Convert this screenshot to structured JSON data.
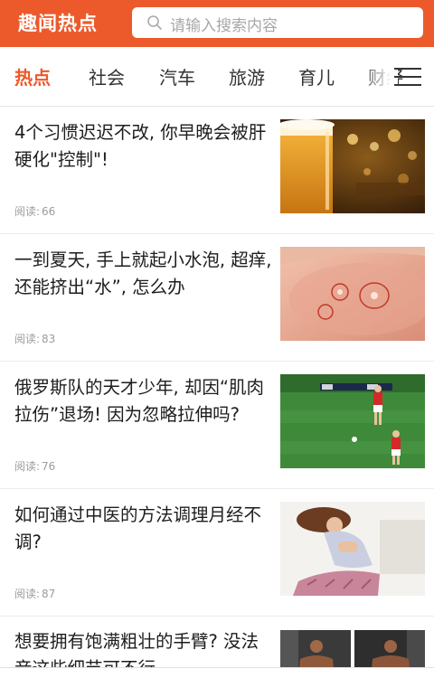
{
  "header": {
    "brand": "趣闻热点",
    "search_placeholder": "请输入搜索内容"
  },
  "tabs": [
    "热点",
    "社会",
    "汽车",
    "旅游",
    "育儿",
    "财经"
  ],
  "active_tab": "热点",
  "feed": [
    {
      "title": "4个习惯迟迟不改, 你早晚会被肝硬化\"控制\"!",
      "read_label": "阅读:",
      "reads": "66",
      "image": "beer-bar-photo"
    },
    {
      "title": "一到夏天, 手上就起小水泡, 超痒, 还能挤出“水”, 怎么办",
      "read_label": "阅读:",
      "reads": "83",
      "image": "finger-blister-photo"
    },
    {
      "title": "俄罗斯队的天才少年, 却因“肌肉拉伤”退场! 因为忽略拉伸吗?",
      "read_label": "阅读:",
      "reads": "76",
      "image": "soccer-match-photo"
    },
    {
      "title": "如何通过中医的方法调理月经不调?",
      "read_label": "阅读:",
      "reads": "87",
      "image": "woman-stomachache-photo"
    }
  ],
  "partial_item": {
    "title": "想要拥有饱满粗壮的手臂? 没法音这些细节可不行",
    "images": [
      "bodybuilder-photo-1",
      "bodybuilder-photo-2"
    ]
  },
  "colors": {
    "accent": "#ec5a2b",
    "text": "#1d1d1d",
    "meta": "#9b9b9b"
  },
  "icons": {
    "search": "search-icon",
    "menu": "hamburger-menu-icon"
  }
}
